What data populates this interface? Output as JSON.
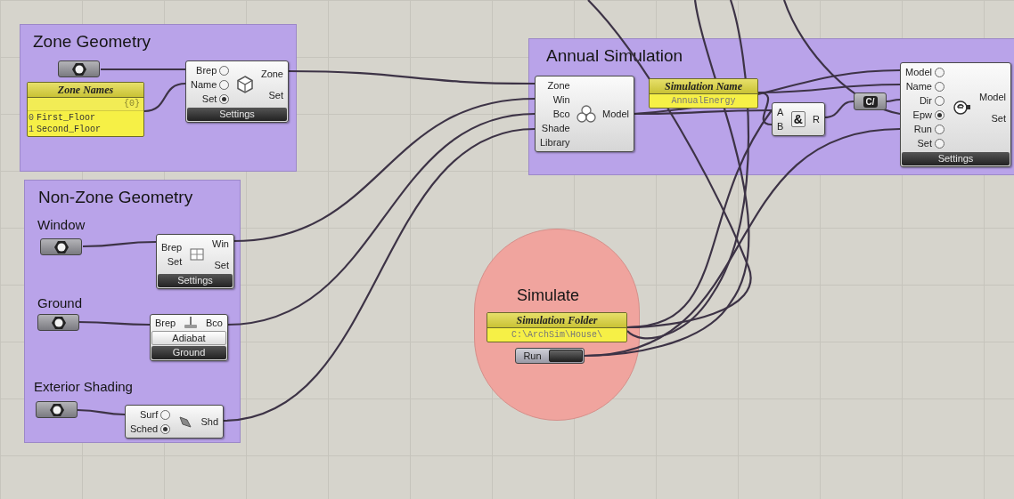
{
  "groups": [
    {
      "title": "Zone Geometry"
    },
    {
      "title": "Annual Simulation"
    },
    {
      "title": "Non-Zone Geometry"
    }
  ],
  "sublabels": [
    "Window",
    "Ground",
    "Exterior Shading"
  ],
  "simulate_bubble": {
    "title": "Simulate"
  },
  "panels": [
    {
      "title": "Zone Names",
      "path": "{0}",
      "items": [
        {
          "index": "0",
          "text": "First_Floor"
        },
        {
          "index": "1",
          "text": "Second_Floor"
        }
      ]
    },
    {
      "title": "Simulation Name",
      "items": [
        {
          "text": "AnnualEnergy"
        }
      ]
    },
    {
      "title": "Simulation Folder",
      "items": [
        {
          "text": "C:\\ArchSim\\House\\"
        }
      ]
    }
  ],
  "components": [
    {
      "inputs": [
        {
          "label": "Brep",
          "kind": "radio",
          "checked": false
        },
        {
          "label": "Name",
          "kind": "radio",
          "checked": false
        },
        {
          "label": "Set",
          "kind": "radio",
          "checked": true
        }
      ],
      "outputs": [
        "Zone",
        "Set"
      ],
      "buttons": [
        {
          "label": "Settings",
          "kind": "dark"
        }
      ]
    },
    {
      "inputs": [
        {
          "label": "Zone",
          "kind": "plain"
        },
        {
          "label": "Win",
          "kind": "plain"
        },
        {
          "label": "Bco",
          "kind": "plain"
        },
        {
          "label": "Shade",
          "kind": "plain"
        },
        {
          "label": "Library",
          "kind": "plain"
        }
      ],
      "outputs": [
        "Model"
      ]
    },
    {
      "symbol": "&",
      "inputs": [
        {
          "label": "A",
          "kind": "plain"
        },
        {
          "label": "B",
          "kind": "plain"
        }
      ],
      "outputs": [
        "R"
      ]
    },
    {
      "inputs": [
        {
          "label": "Model",
          "kind": "radio",
          "checked": false
        },
        {
          "label": "Name",
          "kind": "radio",
          "checked": false
        },
        {
          "label": "Dir",
          "kind": "radio",
          "checked": false
        },
        {
          "label": "Epw",
          "kind": "radio",
          "checked": true
        },
        {
          "label": "Run",
          "kind": "radio",
          "checked": false
        },
        {
          "label": "Set",
          "kind": "radio",
          "checked": false
        }
      ],
      "outputs": [
        "Model",
        "Set"
      ],
      "buttons": [
        {
          "label": "Settings",
          "kind": "dark"
        }
      ]
    },
    {
      "inputs": [
        {
          "label": "Brep",
          "kind": "plain"
        },
        {
          "label": "Set",
          "kind": "plain"
        }
      ],
      "outputs": [
        "Win",
        "Set"
      ],
      "buttons": [
        {
          "label": "Settings",
          "kind": "dark"
        }
      ]
    },
    {
      "inputs": [
        {
          "label": "Brep",
          "kind": "plain"
        }
      ],
      "outputs": [
        "Bco"
      ],
      "buttons": [
        {
          "label": "Adiabat",
          "kind": "light"
        },
        {
          "label": "Ground",
          "kind": "dark"
        }
      ]
    },
    {
      "inputs": [
        {
          "label": "Surf",
          "kind": "radio",
          "checked": false
        },
        {
          "label": "Sched",
          "kind": "radio",
          "checked": true
        }
      ],
      "outputs": [
        "Shd"
      ]
    }
  ],
  "text_param": {
    "symbol": "C/"
  },
  "toggle": {
    "label": "Run",
    "on": false
  }
}
